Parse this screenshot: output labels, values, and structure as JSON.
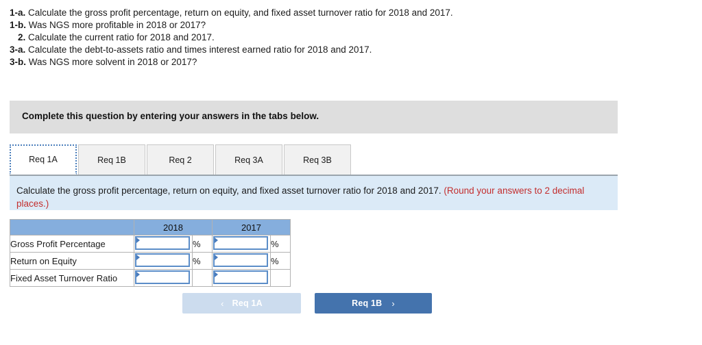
{
  "questions": [
    {
      "num": "1-a.",
      "text": "Calculate the gross profit percentage, return on equity, and fixed asset turnover ratio for 2018 and 2017.",
      "indent": false
    },
    {
      "num": "1-b.",
      "text": "Was NGS more profitable in 2018 or 2017?",
      "indent": false
    },
    {
      "num": "2.",
      "text": "Calculate the current ratio for 2018 and 2017.",
      "indent": true
    },
    {
      "num": "3-a.",
      "text": "Calculate the debt-to-assets ratio and times interest earned ratio for 2018 and 2017.",
      "indent": false
    },
    {
      "num": "3-b.",
      "text": "Was NGS more solvent in 2018 or 2017?",
      "indent": false
    }
  ],
  "banner": {
    "text": "Complete this question by entering your answers in the tabs below.",
    "background_color": "#dedede"
  },
  "tabs": [
    {
      "label": "Req 1A",
      "active": true
    },
    {
      "label": "Req 1B",
      "active": false
    },
    {
      "label": "Req 2",
      "active": false
    },
    {
      "label": "Req 3A",
      "active": false
    },
    {
      "label": "Req 3B",
      "active": false
    }
  ],
  "requirement": {
    "main_text": "Calculate the gross profit percentage, return on equity, and fixed asset turnover ratio for 2018 and 2017. ",
    "round_note": "(Round your answers to 2 decimal places.)",
    "background_color": "#dbeaf7",
    "note_color": "#c32e2e"
  },
  "answer_table": {
    "header_color": "#85aedd",
    "columns": [
      "",
      "2018",
      "2017"
    ],
    "rows": [
      {
        "label": "Gross Profit Percentage",
        "value_2018": "",
        "unit_2018": "%",
        "value_2017": "",
        "unit_2017": "%"
      },
      {
        "label": "Return on Equity",
        "value_2018": "",
        "unit_2018": "%",
        "value_2017": "",
        "unit_2017": "%"
      },
      {
        "label": "Fixed Asset Turnover Ratio",
        "value_2018": "",
        "unit_2018": "",
        "value_2017": "",
        "unit_2017": ""
      }
    ]
  },
  "navigation": {
    "prev_label": "Req 1A",
    "prev_chevron": "‹",
    "prev_disabled": true,
    "prev_color": "#ccdcee",
    "next_label": "Req 1B",
    "next_chevron": "›",
    "next_color": "#4473ad"
  }
}
